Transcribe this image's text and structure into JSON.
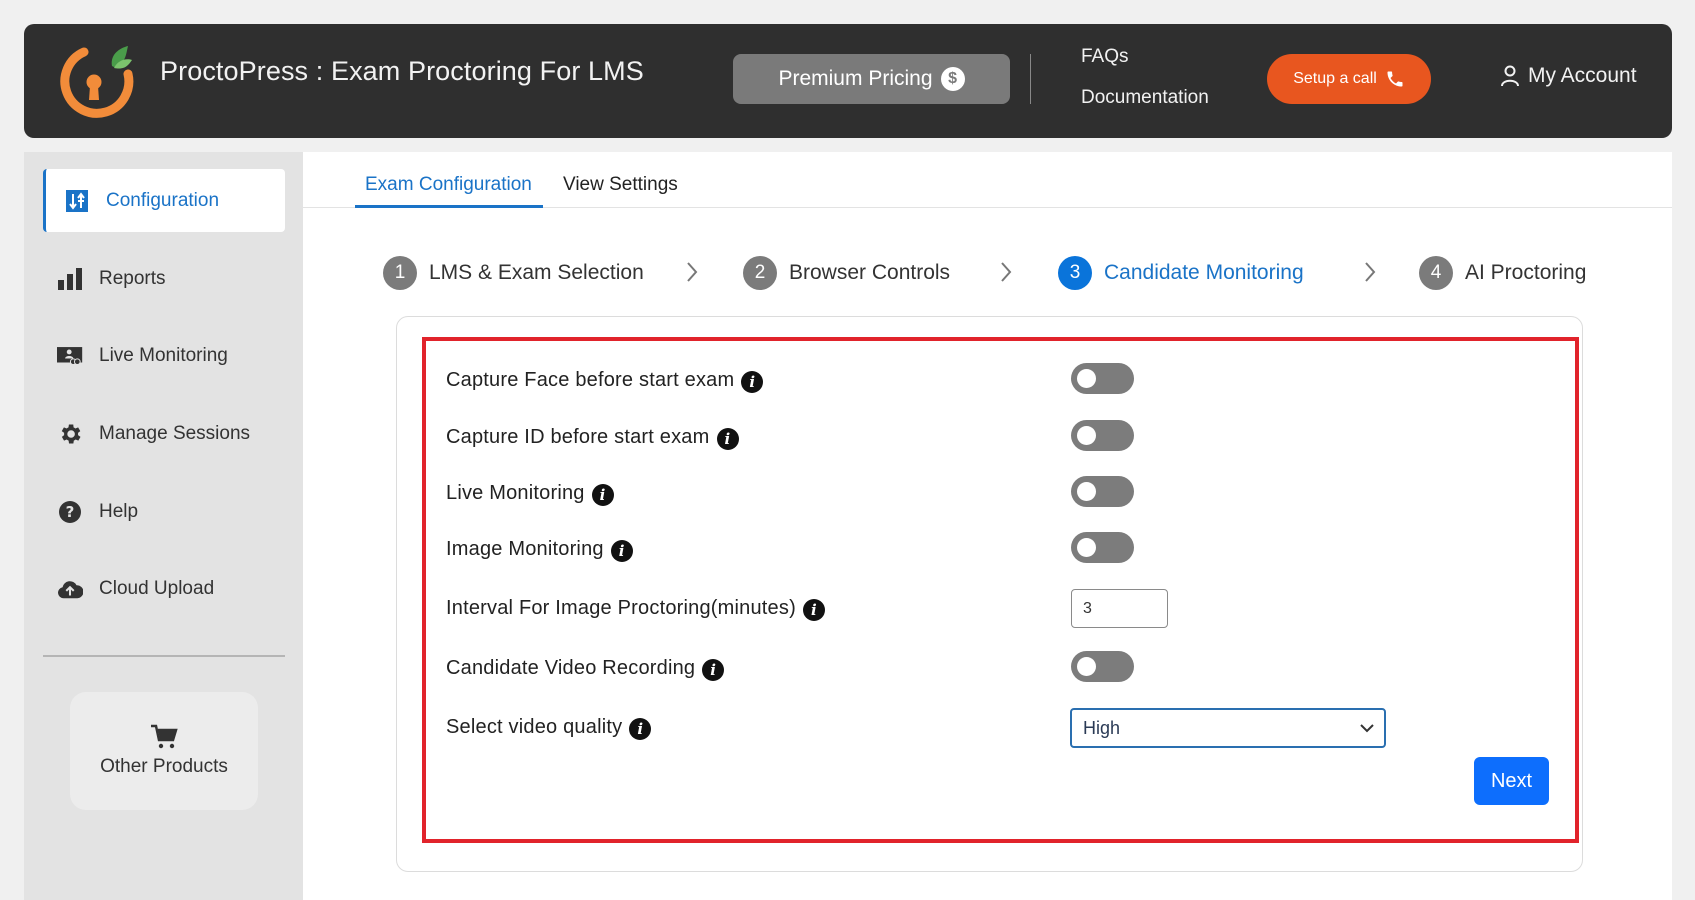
{
  "header": {
    "app_title": "ProctoPress : Exam Proctoring For LMS",
    "premium_label": "Premium Pricing",
    "faqs_label": "FAQs",
    "documentation_label": "Documentation",
    "setup_call_label": "Setup a call",
    "account_label": "My Account"
  },
  "sidebar": {
    "items": [
      {
        "label": "Configuration",
        "icon": "sliders-icon",
        "active": true
      },
      {
        "label": "Reports",
        "icon": "bar-chart-icon"
      },
      {
        "label": "Live Monitoring",
        "icon": "monitor-user-icon"
      },
      {
        "label": "Manage Sessions",
        "icon": "gear-icon"
      },
      {
        "label": "Help",
        "icon": "question-icon"
      },
      {
        "label": "Cloud Upload",
        "icon": "cloud-upload-icon"
      }
    ],
    "other_products_label": "Other Products"
  },
  "tabs": [
    {
      "label": "Exam Configuration",
      "active": true
    },
    {
      "label": "View Settings"
    }
  ],
  "steps": [
    {
      "num": "1",
      "label": "LMS & Exam Selection"
    },
    {
      "num": "2",
      "label": "Browser Controls"
    },
    {
      "num": "3",
      "label": "Candidate Monitoring",
      "active": true
    },
    {
      "num": "4",
      "label": "AI Proctoring"
    }
  ],
  "form": {
    "capture_face": {
      "label": "Capture Face before start exam",
      "enabled": false
    },
    "capture_id": {
      "label": "Capture ID before start exam",
      "enabled": false
    },
    "live_monitoring": {
      "label": "Live Monitoring",
      "enabled": false
    },
    "image_monitoring": {
      "label": "Image Monitoring",
      "enabled": false
    },
    "interval": {
      "label": "Interval For Image Proctoring(minutes)",
      "value": "3"
    },
    "video_recording": {
      "label": "Candidate Video Recording",
      "enabled": false
    },
    "video_quality": {
      "label": "Select video quality",
      "value": "High"
    },
    "next_label": "Next"
  },
  "colors": {
    "accent": "#1a73c7",
    "call_button": "#e8561f",
    "highlight_border": "#e1232b",
    "next_button": "#0d6efd"
  }
}
